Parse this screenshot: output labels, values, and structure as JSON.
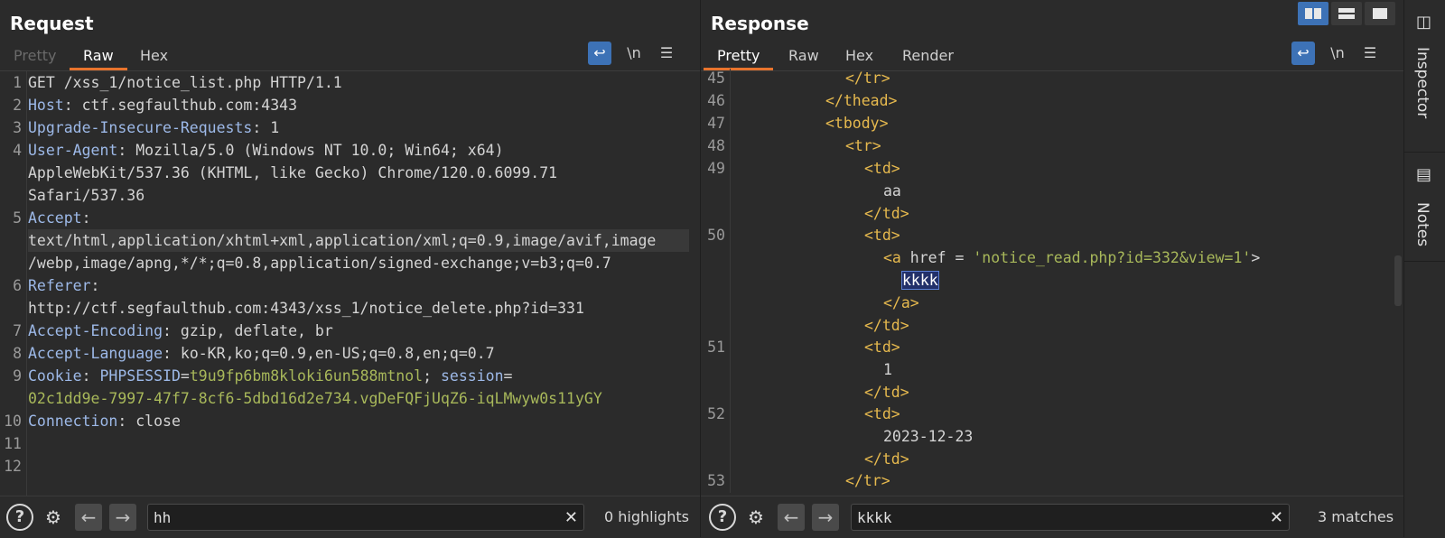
{
  "request": {
    "title": "Request",
    "tabs": [
      {
        "label": "Pretty",
        "state": "disabled"
      },
      {
        "label": "Raw",
        "state": "active"
      },
      {
        "label": "Hex",
        "state": "normal"
      }
    ],
    "toolbar_icons": [
      "wrap-lines-icon",
      "newline-toggle-icon",
      "menu-icon"
    ],
    "newline_label": "\\n",
    "line_numbers": [
      "1",
      "2",
      "3",
      "4",
      "5",
      "6",
      "7",
      "8",
      "9",
      "10",
      "11",
      "12"
    ],
    "lines": {
      "l1": "GET /xss_1/notice_list.php HTTP/1.1",
      "l2_key": "Host",
      "l2_val": ": ctf.segfaulthub.com:4343",
      "l3_key": "Upgrade-Insecure-Requests",
      "l3_val": ": 1",
      "l4_key": "User-Agent",
      "l4_val": ": Mozilla/5.0 (Windows NT 10.0; Win64; x64)",
      "l4b": "AppleWebKit/537.36 (KHTML, like Gecko) Chrome/120.0.6099.71",
      "l4c": "Safari/537.36",
      "l5_key": "Accept",
      "l5_val": ":",
      "l5b": "text/html,application/xhtml+xml,application/xml;q=0.9,image/avif,image",
      "l5c": "/webp,image/apng,*/*;q=0.8,application/signed-exchange;v=b3;q=0.7",
      "l6_key": "Referer",
      "l6_val": ":",
      "l6b": "http://ctf.segfaulthub.com:4343/xss_1/notice_delete.php?id=331",
      "l7_key": "Accept-Encoding",
      "l7_val": ": gzip, deflate, br",
      "l8_key": "Accept-Language",
      "l8_val": ": ko-KR,ko;q=0.9,en-US;q=0.8,en;q=0.7",
      "l9_key": "Cookie",
      "l9_sep": ": ",
      "l9_c1name": "PHPSESSID",
      "l9_c1val": "t9u9fp6bm8kloki6un588mtnol",
      "l9_sep2": "; ",
      "l9_c2name": "session",
      "l9_eq": "=",
      "l9b": "02c1dd9e-7997-47f7-8cf6-5dbd16d2e734.vgDeFQFjUqZ6-iqLMwyw0s11yGY",
      "l10_key": "Connection",
      "l10_val": ": close"
    },
    "search": {
      "value": "hh",
      "count": "0 highlights"
    }
  },
  "response": {
    "title": "Response",
    "tabs": [
      {
        "label": "Pretty",
        "state": "active"
      },
      {
        "label": "Raw",
        "state": "normal"
      },
      {
        "label": "Hex",
        "state": "normal"
      },
      {
        "label": "Render",
        "state": "normal"
      }
    ],
    "newline_label": "\\n",
    "line_numbers": [
      "45",
      "46",
      "47",
      "48",
      "49",
      "50",
      "51",
      "52",
      "53"
    ],
    "lines": {
      "r45": "</tr>",
      "r46": "</thead>",
      "r47": "<tbody>",
      "r48": "<tr>",
      "r49": "<td>",
      "r49b": "aa",
      "r49c": "</td>",
      "r50": "<td>",
      "r50a_open": "<a",
      "r50a_attr": " href = ",
      "r50a_val": "'notice_read.php?id=332&view=1'",
      "r50a_close": ">",
      "r50b": "kkkk",
      "r50c": "</a>",
      "r50d": "</td>",
      "r51": "<td>",
      "r51b": "1",
      "r51c": "</td>",
      "r52": "<td>",
      "r52b": "2023-12-23",
      "r52c": "</td>",
      "r53": "</tr>"
    },
    "search": {
      "value": "kkkk",
      "count": "3 matches"
    }
  },
  "sidebar": {
    "items": [
      {
        "label": "Inspector",
        "icon": "inspector-icon"
      },
      {
        "label": "Notes",
        "icon": "notes-icon"
      }
    ]
  },
  "layout_buttons": [
    "side-by-side-layout-icon",
    "stacked-layout-icon",
    "single-layout-icon"
  ],
  "colors": {
    "accent": "#e8742d",
    "blue": "#3d72b6",
    "key": "#9db9e8",
    "value": "#a8b85a",
    "tag": "#e6b94e"
  }
}
